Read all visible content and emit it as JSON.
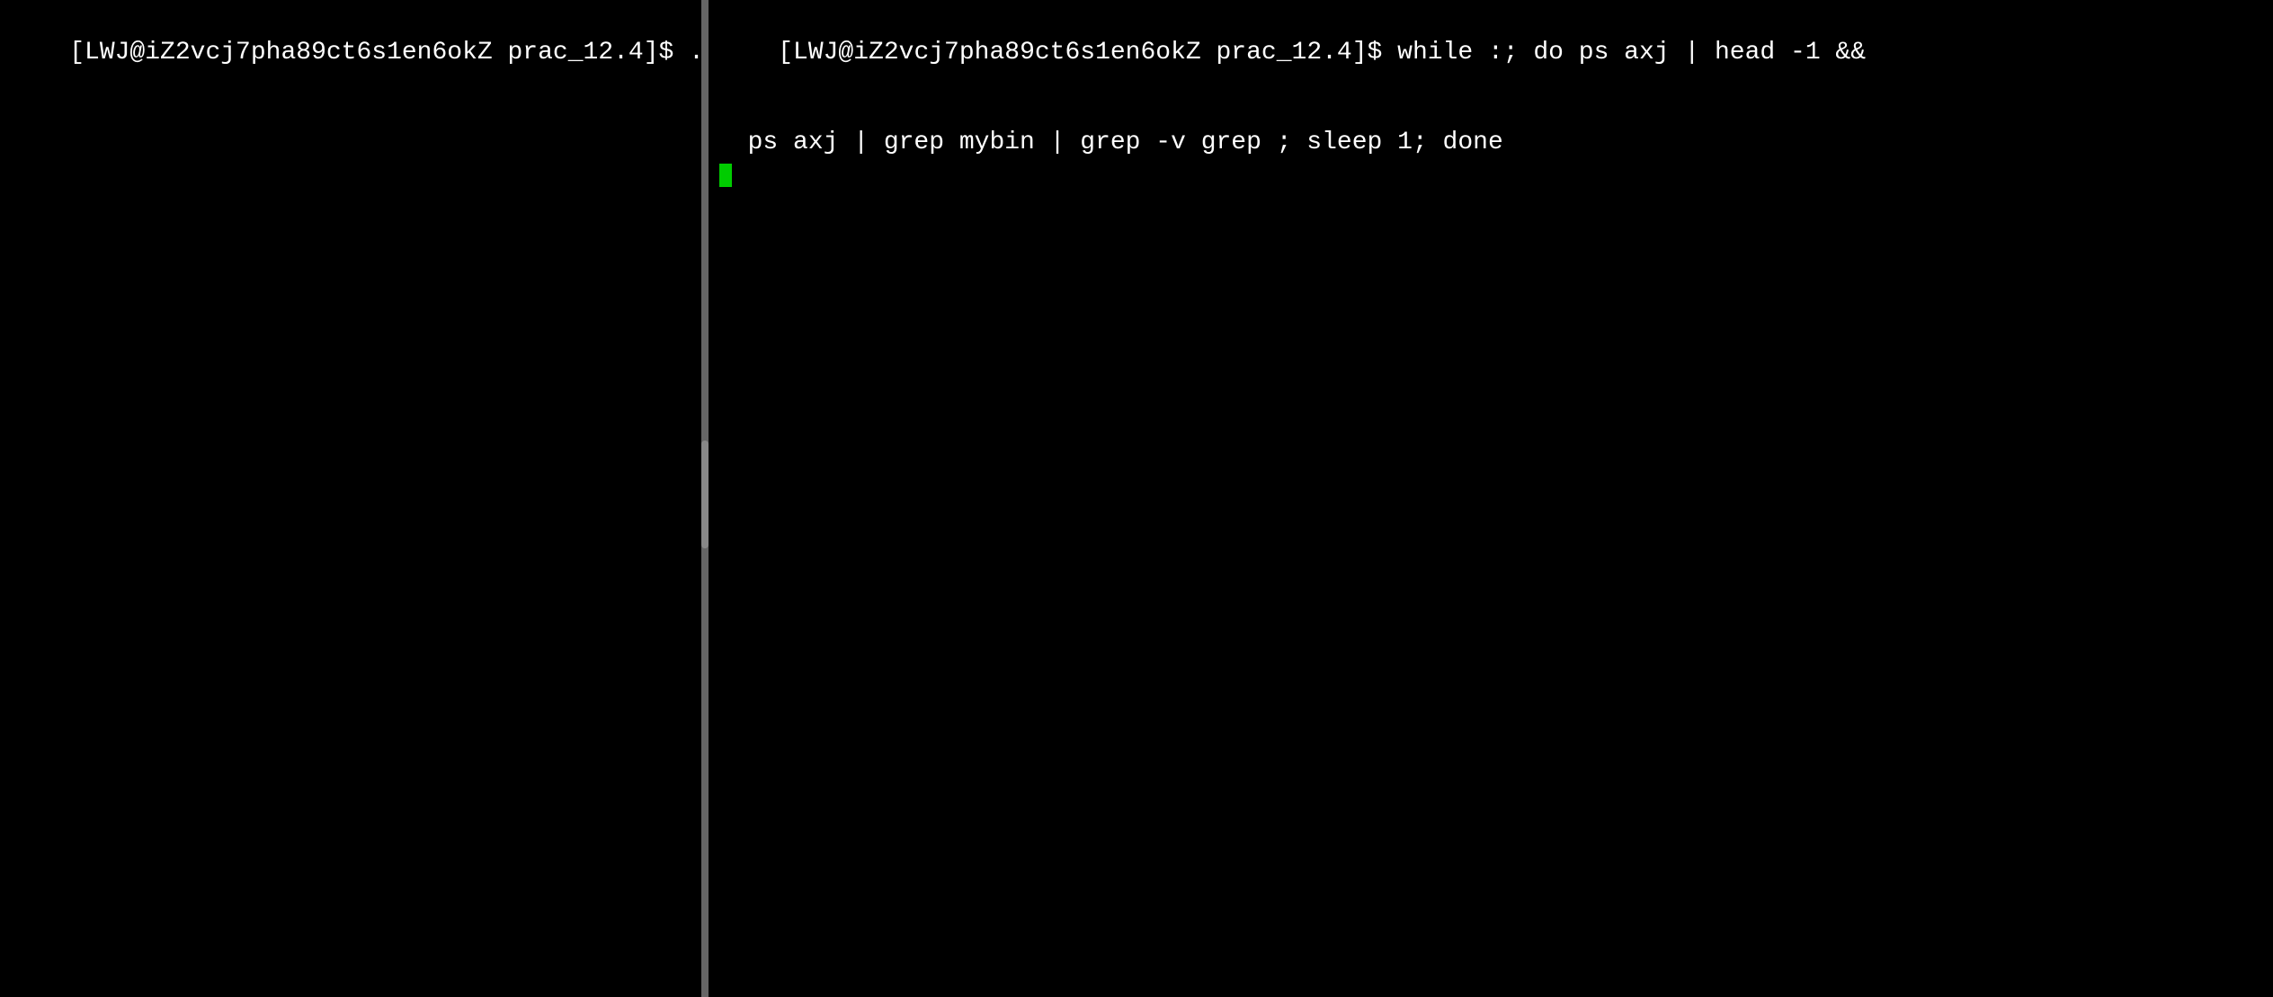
{
  "left_pane": {
    "prompt": "[LWJ@iZ2vcj7pha89ct6s1en6okZ prac_12.4]$ ",
    "command": "./mybin"
  },
  "right_pane": {
    "line1_prompt": "[LWJ@iZ2vcj7pha89ct6s1en6okZ prac_12.4]$ ",
    "line1_command": "while :; do ps axj | head -1 &&",
    "line2": "  ps axj | grep mybin | grep -v grep ; sleep 1; done"
  },
  "divider": {
    "color": "#888"
  }
}
